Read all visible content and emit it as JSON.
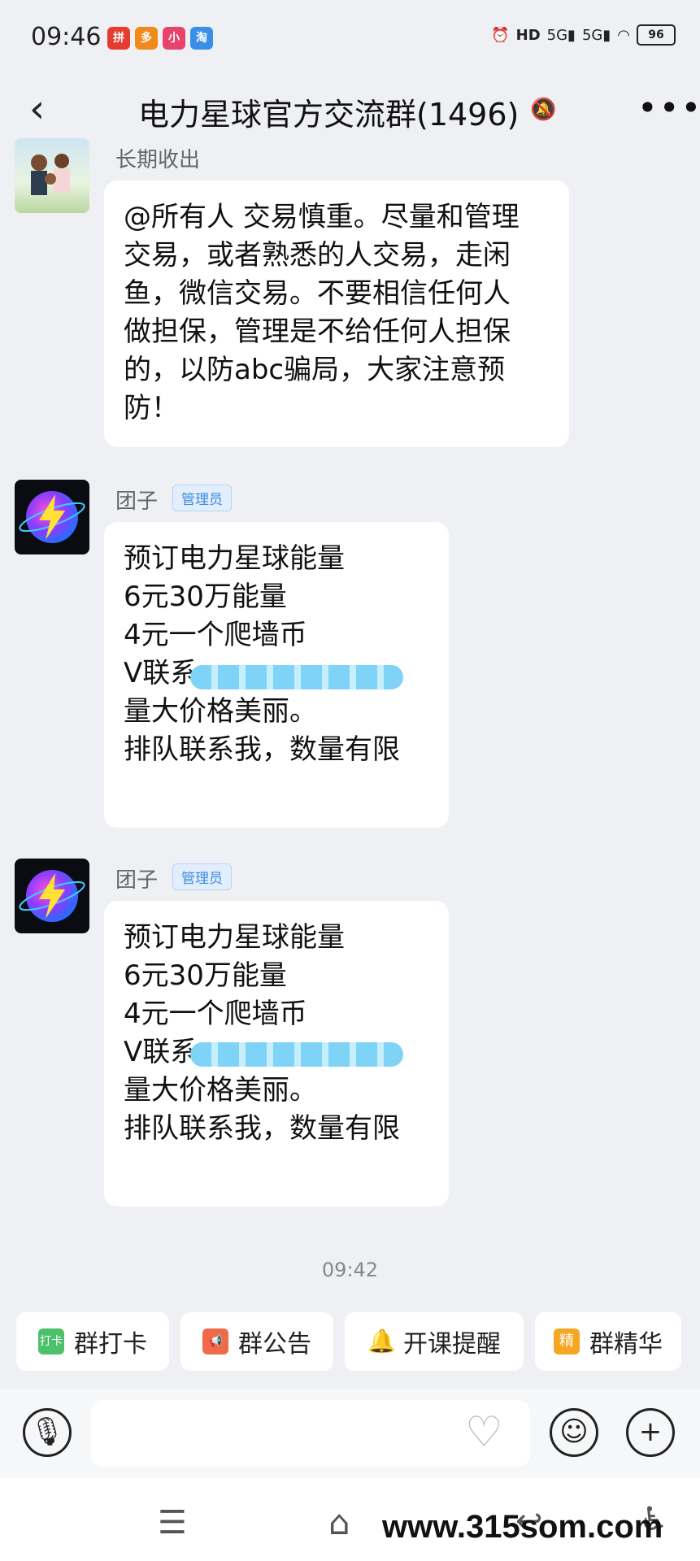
{
  "status_bar": {
    "time": "09:46",
    "icons": [
      "hd-icon",
      "signal-5g-icon",
      "signal-5g-icon",
      "wifi-icon",
      "alarm-icon"
    ],
    "battery": "96"
  },
  "header": {
    "title": "电力星球官方交流群(1496)",
    "back_icon": "chevron-left-icon",
    "mute_icon": "bell-muted-icon",
    "more_icon": "more-icon"
  },
  "messages": [
    {
      "sender": "长期收出",
      "text": "@所有人 交易慎重。尽量和管理\n交易，或者熟悉的人交易，走闲\n鱼，微信交易。不要相信任何人\n做担保，管理是不给任何人担保\n的，以防abc骗局，大家注意预\n防！"
    },
    {
      "sender": "团子",
      "badge": "管理员",
      "text": "预订电力星球能量\n6元30万能量\n4元一个爬墙币\nV联系\n量大价格美丽。\n排队联系我，数量有限"
    },
    {
      "sender": "团子",
      "badge": "管理员",
      "text": "预订电力星球能量\n6元30万能量\n4元一个爬墙币\nV联系\n量大价格美丽。\n排队联系我，数量有限"
    }
  ],
  "timestamp": "09:42",
  "quick_actions": [
    {
      "label": "群打卡",
      "icon": "打卡",
      "color": "#4cc16a"
    },
    {
      "label": "群公告",
      "icon": "",
      "color": "#f06a4a"
    },
    {
      "label": "开课提醒",
      "icon": "",
      "color": "#ee3a3a"
    },
    {
      "label": "群精华",
      "icon": "精",
      "color": "#f5a623"
    }
  ],
  "input": {
    "placeholder": ""
  },
  "watermark": "www.315som.com"
}
